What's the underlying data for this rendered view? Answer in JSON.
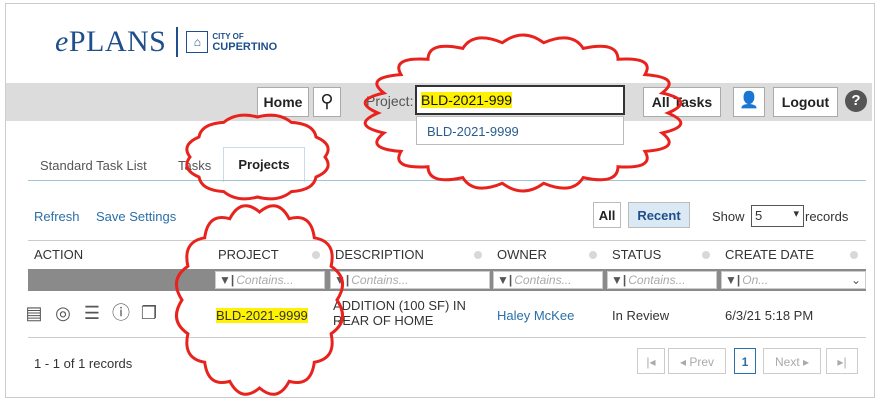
{
  "header": {
    "logo_prefix": "e",
    "logo_main": "PLANS",
    "city_line1": "CITY OF",
    "city_line2": "CUPERTINO"
  },
  "toolbar": {
    "home_label": "Home",
    "project_label": "Project:",
    "project_value": "BLD-2021-999",
    "dropdown_option": "BLD-2021-9999",
    "all_tasks_label": "All Tasks",
    "logout_label": "Logout"
  },
  "tabs": [
    {
      "label": "Standard Task List"
    },
    {
      "label": "Tasks"
    },
    {
      "label": "Projects"
    }
  ],
  "controls": {
    "refresh": "Refresh",
    "save_settings": "Save Settings",
    "all": "All",
    "recent": "Recent",
    "show": "Show",
    "page_size": "5",
    "records": "records"
  },
  "table": {
    "columns": [
      "ACTION",
      "PROJECT",
      "DESCRIPTION",
      "OWNER",
      "STATUS",
      "CREATE DATE"
    ],
    "filters": [
      "Contains...",
      "Contains...",
      "Contains...",
      "Contains...",
      "On..."
    ],
    "rows": [
      {
        "project": "BLD-2021-9999",
        "description_line1": "ADDITION (100 SF) IN",
        "description_line2": "REAR OF HOME",
        "owner": "Haley McKee",
        "status": "In Review",
        "create_date": "6/3/21 5:18 PM"
      }
    ]
  },
  "footer": {
    "record_count": "1 - 1 of 1 records",
    "prev": "◂ Prev",
    "page": "1",
    "next": "Next ▸"
  },
  "colors": {
    "highlight": "#fff200",
    "annotation": "#e8231e",
    "link": "#2a6fa8"
  }
}
